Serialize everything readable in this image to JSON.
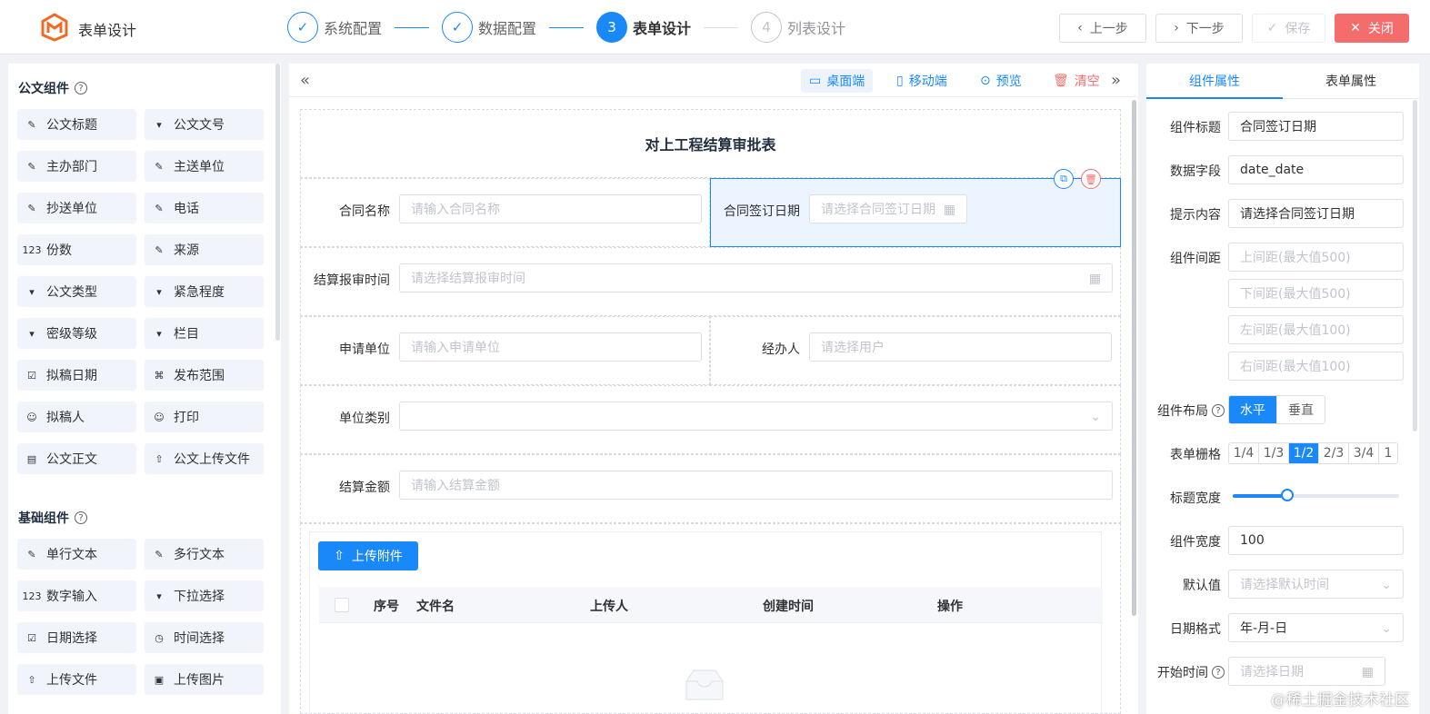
{
  "app": {
    "title": "表单设计"
  },
  "steps": [
    {
      "label": "系统配置",
      "state": "done",
      "number": ""
    },
    {
      "label": "数据配置",
      "state": "done",
      "number": ""
    },
    {
      "label": "表单设计",
      "state": "active",
      "number": "3"
    },
    {
      "label": "列表设计",
      "state": "pending",
      "number": "4"
    }
  ],
  "actions": {
    "prev": "上一步",
    "next": "下一步",
    "save": "保存",
    "close": "关闭"
  },
  "palette": {
    "doc_group": "公文组件",
    "doc_items": [
      {
        "label": "公文标题",
        "icon": "edit-icon"
      },
      {
        "label": "公文文号",
        "icon": "select-icon"
      },
      {
        "label": "主办部门",
        "icon": "edit-icon"
      },
      {
        "label": "主送单位",
        "icon": "edit-icon"
      },
      {
        "label": "抄送单位",
        "icon": "edit-icon"
      },
      {
        "label": "电话",
        "icon": "edit-icon"
      },
      {
        "label": "份数",
        "icon": "number-icon"
      },
      {
        "label": "来源",
        "icon": "edit-icon"
      },
      {
        "label": "公文类型",
        "icon": "select-icon"
      },
      {
        "label": "紧急程度",
        "icon": "select-icon"
      },
      {
        "label": "密级等级",
        "icon": "select-icon"
      },
      {
        "label": "栏目",
        "icon": "select-icon"
      },
      {
        "label": "拟稿日期",
        "icon": "calendar-check-icon"
      },
      {
        "label": "发布范围",
        "icon": "org-tree-icon"
      },
      {
        "label": "拟稿人",
        "icon": "user-icon"
      },
      {
        "label": "打印",
        "icon": "user-icon"
      },
      {
        "label": "公文正文",
        "icon": "document-icon"
      },
      {
        "label": "公文上传文件",
        "icon": "upload-icon"
      }
    ],
    "basic_group": "基础组件",
    "basic_items": [
      {
        "label": "单行文本",
        "icon": "edit-icon"
      },
      {
        "label": "多行文本",
        "icon": "edit-box-icon"
      },
      {
        "label": "数字输入",
        "icon": "number-icon"
      },
      {
        "label": "下拉选择",
        "icon": "select-icon"
      },
      {
        "label": "日期选择",
        "icon": "calendar-check-icon"
      },
      {
        "label": "时间选择",
        "icon": "clock-icon"
      },
      {
        "label": "上传文件",
        "icon": "upload-icon"
      },
      {
        "label": "上传图片",
        "icon": "image-icon"
      }
    ]
  },
  "toolbar": {
    "desktop": "桌面端",
    "mobile": "移动端",
    "preview": "预览",
    "clear": "清空"
  },
  "form": {
    "title": "对上工程结算审批表",
    "fields": {
      "contract_name": {
        "label": "合同名称",
        "placeholder": "请输入合同名称"
      },
      "sign_date": {
        "label": "合同签订日期",
        "placeholder": "请选择合同签订日期"
      },
      "report_time": {
        "label": "结算报审时间",
        "placeholder": "请选择结算报审时间"
      },
      "unit": {
        "label": "申请单位",
        "placeholder": "请输入申请单位"
      },
      "handler": {
        "label": "经办人",
        "placeholder": "请选择用户"
      },
      "unit_type": {
        "label": "单位类别",
        "placeholder": ""
      },
      "amount": {
        "label": "结算金额",
        "placeholder": "请输入结算金额"
      }
    },
    "upload_label": "上传附件",
    "table_headers": [
      "序号",
      "文件名",
      "上传人",
      "创建时间",
      "操作"
    ]
  },
  "props": {
    "tabs": [
      "组件属性",
      "表单属性"
    ],
    "active_tab": 0,
    "title_label": "组件标题",
    "title_value": "合同签订日期",
    "field_label": "数据字段",
    "field_value": "date_date",
    "hint_label": "提示内容",
    "hint_value": "请选择合同签订日期",
    "spacing_label": "组件间距",
    "spacing_placeholders": [
      "上间距(最大值500)",
      "下间距(最大值500)",
      "左间距(最大值100)",
      "右间距(最大值100)"
    ],
    "layout_label": "组件布局",
    "layout_options": [
      "水平",
      "垂直"
    ],
    "layout_selected": 0,
    "grid_label": "表单栅格",
    "grid_options": [
      "1/4",
      "1/3",
      "1/2",
      "2/3",
      "3/4",
      "1"
    ],
    "grid_selected": 2,
    "label_width_label": "标题宽度",
    "label_width_fraction": 0.33,
    "comp_width_label": "组件宽度",
    "comp_width_value": "100",
    "default_label": "默认值",
    "default_placeholder": "请选择默认时间",
    "format_label": "日期格式",
    "format_value": "年-月-日",
    "start_label": "开始时间",
    "start_placeholder": "请选择日期"
  },
  "colors": {
    "primary": "#1989fa",
    "danger": "#f56c6c",
    "logo": "#f06a25"
  },
  "watermark": "@稀土掘金技术社区"
}
